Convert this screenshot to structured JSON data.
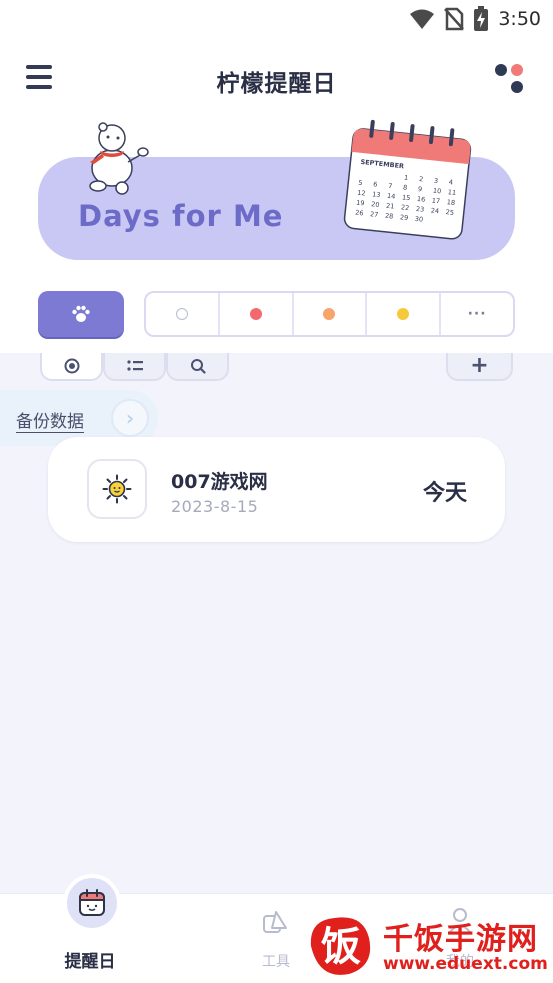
{
  "status_bar": {
    "time": "3:50",
    "icons": [
      "wifi-icon",
      "no-sim-icon",
      "battery-charging-icon"
    ]
  },
  "header": {
    "title": "柠檬提醒日",
    "menu_icon": "hamburger-menu-icon",
    "right_icon": "apps-dots-icon",
    "dot_colors": [
      "#2f3a55",
      "#f07a78",
      "#2f3a55",
      "#2f3a55"
    ]
  },
  "banner": {
    "text": "Days for Me",
    "calendar_month": "SEPTEMBER",
    "calendar_rows": [
      [
        "",
        "",
        "",
        "1",
        "2",
        "3",
        "4"
      ],
      [
        "5",
        "6",
        "7",
        "8",
        "9",
        "10",
        "11"
      ],
      [
        "12",
        "13",
        "14",
        "15",
        "16",
        "17",
        "18"
      ],
      [
        "19",
        "20",
        "21",
        "22",
        "23",
        "24",
        "25"
      ],
      [
        "26",
        "27",
        "28",
        "29",
        "30",
        "",
        ""
      ]
    ],
    "background": "#c9c8f5",
    "text_color": "#6d6bc8"
  },
  "categories": {
    "active_icon": "paw-icon",
    "colors": [
      {
        "name": "none",
        "color": "#ffffff"
      },
      {
        "name": "red",
        "color": "#f06a6e"
      },
      {
        "name": "orange",
        "color": "#f7a56b"
      },
      {
        "name": "yellow",
        "color": "#f6c93a"
      }
    ],
    "more_label": "···",
    "accent": "#7c7ad3"
  },
  "view_tabs": {
    "tabs": [
      "target-icon",
      "list-icon",
      "search-icon"
    ],
    "add_label": "+"
  },
  "backup": {
    "label": "备份数据",
    "arrow": "›"
  },
  "events": [
    {
      "icon": "sun-face-icon",
      "title": "007游戏网",
      "date": "2023-8-15",
      "days": "今天"
    }
  ],
  "bottom_nav": {
    "items": [
      {
        "label": "提醒日",
        "icon": "calendar-face-icon",
        "active": true
      },
      {
        "label": "工具",
        "icon": "tools-icon",
        "active": false
      },
      {
        "label": "我的",
        "icon": "user-icon",
        "active": false
      }
    ]
  },
  "watermark": {
    "logo_char": "饭",
    "name": "千饭手游网",
    "url": "www.eduext.com"
  }
}
